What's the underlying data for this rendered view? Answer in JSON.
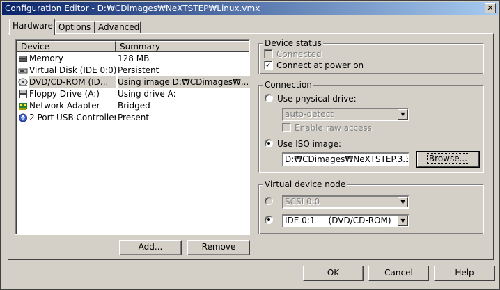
{
  "window": {
    "title": "Configuration Editor - D:₩CDimages₩NeXTSTEP₩Linux.vmx",
    "close_glyph": "✕"
  },
  "tabs": [
    {
      "label": "Hardware",
      "active": true
    },
    {
      "label": "Options",
      "active": false
    },
    {
      "label": "Advanced",
      "active": false
    }
  ],
  "device_list": {
    "columns": [
      "Device",
      "Summary"
    ],
    "rows": [
      {
        "icon": "memory-icon",
        "device": "Memory",
        "summary": "128 MB",
        "selected": false
      },
      {
        "icon": "hard-disk-icon",
        "device": "Virtual Disk (IDE 0:0)",
        "summary": "Persistent",
        "selected": false
      },
      {
        "icon": "cdrom-icon",
        "device": "DVD/CD-ROM (ID...",
        "summary": "Using image D:₩CDimages₩...",
        "selected": true
      },
      {
        "icon": "floppy-icon",
        "device": "Floppy Drive (A:)",
        "summary": "Using drive A:",
        "selected": false
      },
      {
        "icon": "network-adapter-icon",
        "device": "Network Adapter",
        "summary": "Bridged",
        "selected": false
      },
      {
        "icon": "usb-icon",
        "device": "2 Port USB Controller",
        "summary": "Present",
        "selected": false
      }
    ]
  },
  "list_buttons": {
    "add": "Add...",
    "remove": "Remove"
  },
  "device_status": {
    "title": "Device status",
    "connected": {
      "label": "Connected",
      "checked": false,
      "enabled": false
    },
    "connect_at_power_on": {
      "label": "Connect at power on",
      "checked": true,
      "enabled": true
    }
  },
  "connection": {
    "title": "Connection",
    "use_physical_drive": {
      "label": "Use physical drive:",
      "selected": false
    },
    "physical_drive_value": "auto-detect",
    "enable_raw_access": {
      "label": "Enable raw access",
      "checked": false,
      "enabled": false
    },
    "use_iso_image": {
      "label": "Use ISO image:",
      "selected": true
    },
    "iso_path": "D:₩CDimages₩NeXTSTEP.3.3",
    "browse": "Browse..."
  },
  "virtual_device_node": {
    "title": "Virtual device node",
    "scsi": {
      "value": "SCSI 0:0",
      "selected": false,
      "enabled": false
    },
    "ide": {
      "value": "IDE 0:1     (DVD/CD-ROM)",
      "selected": true,
      "enabled": true
    }
  },
  "footer": {
    "ok": "OK",
    "cancel": "Cancel",
    "help": "Help"
  },
  "colors": {
    "titlebar_start": "#0a246a",
    "titlebar_end": "#a6caf0",
    "face": "#d4d0c8"
  }
}
